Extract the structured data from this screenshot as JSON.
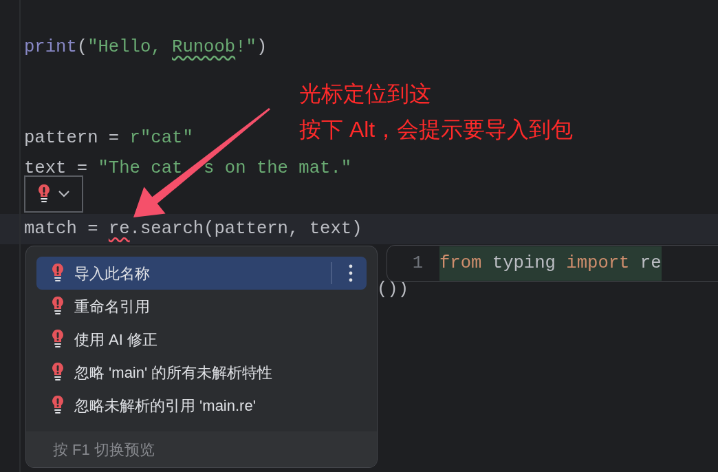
{
  "editor": {
    "lines": [
      {
        "current": false,
        "tokens": [
          {
            "text": "print",
            "kind": "builtin",
            "squiggle": false
          },
          {
            "text": "(",
            "kind": "plain",
            "squiggle": false
          },
          {
            "text": "\"Hello, ",
            "kind": "string",
            "squiggle": false
          },
          {
            "text": "Runoob",
            "kind": "string",
            "squiggle": true
          },
          {
            "text": "!\"",
            "kind": "string",
            "squiggle": false
          },
          {
            "text": ")",
            "kind": "plain",
            "squiggle": false
          }
        ]
      },
      {
        "current": false
      },
      {
        "current": false
      },
      {
        "current": false,
        "tokens": [
          {
            "text": "pattern = ",
            "kind": "plain",
            "squiggle": false
          },
          {
            "text": "r\"cat\"",
            "kind": "string",
            "squiggle": false
          }
        ]
      },
      {
        "current": false,
        "tokens": [
          {
            "text": "text = ",
            "kind": "plain",
            "squiggle": false
          },
          {
            "text": "\"The cat",
            "kind": "string",
            "squiggle": false
          },
          {
            "text": "s on the mat.\"",
            "kind": "string",
            "squiggle": false,
            "covered_before": true
          }
        ]
      },
      {
        "current": false
      },
      {
        "current": true,
        "tokens": [
          {
            "text": "match = ",
            "kind": "plain",
            "squiggle": false
          },
          {
            "text": "re",
            "kind": "plain",
            "squiggle": true
          },
          {
            "text": ".search(pattern, text)",
            "kind": "plain",
            "squiggle": false
          }
        ]
      },
      {
        "current": false
      },
      {
        "current": false,
        "tokens": [
          {
            "text": "())",
            "kind": "plain",
            "squiggle": false
          }
        ]
      }
    ]
  },
  "intention_menu": {
    "items": [
      {
        "label": "导入此名称",
        "selected": true
      },
      {
        "label": "重命名引用",
        "selected": false
      },
      {
        "label": "使用 AI 修正",
        "selected": false
      },
      {
        "label": "忽略 'main' 的所有未解析特性",
        "selected": false
      },
      {
        "label": "忽略未解析的引用 'main.re'",
        "selected": false
      }
    ],
    "footer": "按 F1 切换预览"
  },
  "preview": {
    "line_number": "1",
    "tokens": [
      {
        "text": "from",
        "kind": "keyword"
      },
      {
        "text": " typing ",
        "kind": "plain"
      },
      {
        "text": "import",
        "kind": "keyword"
      },
      {
        "text": " re",
        "kind": "plain"
      }
    ]
  },
  "annotation": {
    "lines": [
      "光标定位到这",
      "按下 Alt，会提示要导入到包"
    ]
  }
}
